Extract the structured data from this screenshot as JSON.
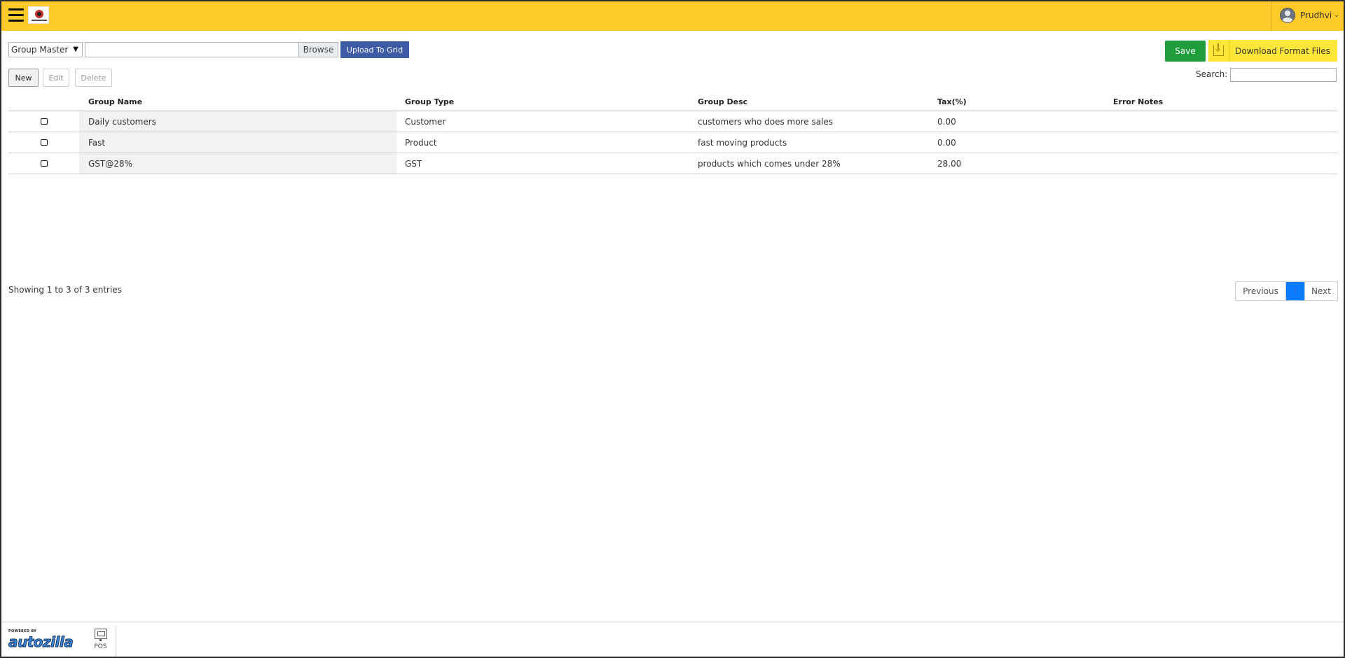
{
  "header": {
    "user_name": "Prudhvi",
    "caret": "⌄"
  },
  "toolbar": {
    "group_select": "Group Master",
    "file_value": "",
    "browse_label": "Browse",
    "upload_label": "Upload To Grid",
    "save_label": "Save",
    "download_label": "Download Format Files"
  },
  "actions": {
    "new_label": "New",
    "edit_label": "Edit",
    "delete_label": "Delete"
  },
  "search": {
    "label": "Search:",
    "value": ""
  },
  "table": {
    "columns": [
      "",
      "Group Name",
      "Group Type",
      "Group Desc",
      "Tax(%)",
      "Error Notes"
    ],
    "rows": [
      {
        "group_name": "Daily customers",
        "group_type": "Customer",
        "group_desc": "customers who does more sales",
        "tax": "0.00",
        "error_notes": ""
      },
      {
        "group_name": "Fast",
        "group_type": "Product",
        "group_desc": "fast moving products",
        "tax": "0.00",
        "error_notes": ""
      },
      {
        "group_name": "GST@28%",
        "group_type": "GST",
        "group_desc": "products which comes under 28%",
        "tax": "28.00",
        "error_notes": ""
      }
    ]
  },
  "pagination": {
    "info": "Showing 1 to 3 of 3 entries",
    "previous": "Previous",
    "current_page": "1",
    "next": "Next"
  },
  "footer": {
    "powered_by": "POWERED BY",
    "brand": "autozilla",
    "pos_label": "POS"
  },
  "colors": {
    "header_bg": "#ffcb2b",
    "upload_btn": "#3e5ba6",
    "save_btn": "#1f9d3a",
    "download_btn": "#ffe739",
    "active_page": "#0b7bff"
  },
  "icons": {
    "menu": "hamburger-icon",
    "user": "avatar",
    "download": "download-icon",
    "pos": "pos-icon"
  }
}
